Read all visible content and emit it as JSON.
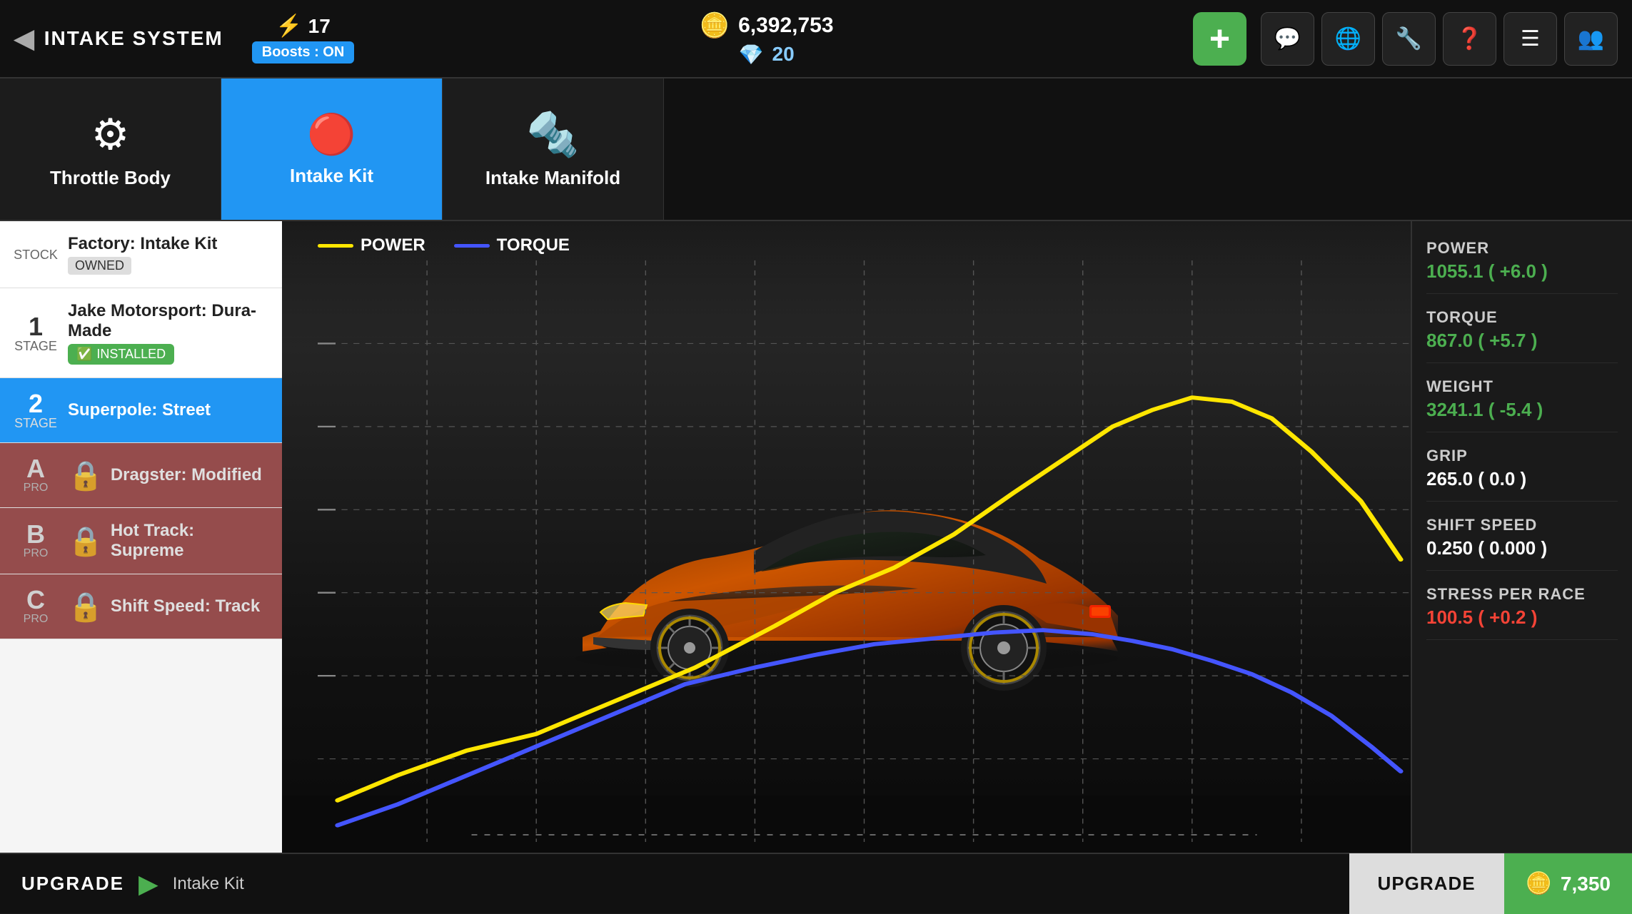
{
  "header": {
    "back_label": "INTAKE SYSTEM",
    "energy_count": "17",
    "boosts_label": "Boosts : ON",
    "currency": "6,392,753",
    "gems": "20",
    "add_label": "+",
    "icons": [
      "💬",
      "🌐",
      "🔧",
      "❓",
      "☰",
      "👥"
    ]
  },
  "tabs": [
    {
      "id": "throttle-body",
      "label": "Throttle Body",
      "icon": "⚙"
    },
    {
      "id": "intake-kit",
      "label": "Intake Kit",
      "icon": "🔴",
      "active": true
    },
    {
      "id": "intake-manifold",
      "label": "Intake Manifold",
      "icon": "🔩"
    }
  ],
  "upgrades": [
    {
      "id": "stock",
      "stage": "",
      "stage_label": "STOCK",
      "name": "Factory: Intake Kit",
      "status": "owned",
      "status_label": "OWNED",
      "locked": false,
      "selected": false
    },
    {
      "id": "stage1",
      "stage": "1",
      "stage_label": "STAGE",
      "name": "Jake Motorsport: Dura-Made",
      "status": "installed",
      "status_label": "INSTALLED",
      "locked": false,
      "selected": false
    },
    {
      "id": "stage2",
      "stage": "2",
      "stage_label": "STAGE",
      "name": "Superpole: Street",
      "status": "selected",
      "locked": false,
      "selected": true
    },
    {
      "id": "stagea",
      "stage": "A",
      "stage_label": "PRO",
      "name": "Dragster: Modified",
      "status": "locked",
      "locked": true,
      "selected": false
    },
    {
      "id": "stageb",
      "stage": "B",
      "stage_label": "PRO",
      "name": "Hot Track: Supreme",
      "status": "locked",
      "locked": true,
      "selected": false
    },
    {
      "id": "stagec",
      "stage": "C",
      "stage_label": "PRO",
      "name": "Shift Speed: Track",
      "status": "locked",
      "locked": true,
      "selected": false
    }
  ],
  "graph": {
    "legend": [
      {
        "id": "power",
        "label": "POWER",
        "color": "#FFE600"
      },
      {
        "id": "torque",
        "label": "TORQUE",
        "color": "#4455FF"
      }
    ]
  },
  "stats": [
    {
      "id": "power",
      "label": "POWER",
      "value": "1055.1 ( +6.0 )",
      "type": "positive"
    },
    {
      "id": "torque",
      "label": "TORQUE",
      "value": "867.0 ( +5.7 )",
      "type": "positive"
    },
    {
      "id": "weight",
      "label": "WEIGHT",
      "value": "3241.1 ( -5.4 )",
      "type": "positive"
    },
    {
      "id": "grip",
      "label": "GRIP",
      "value": "265.0 ( 0.0 )",
      "type": "neutral"
    },
    {
      "id": "shift-speed",
      "label": "SHIFT SPEED",
      "value": "0.250 ( 0.000 )",
      "type": "neutral"
    },
    {
      "id": "stress",
      "label": "STRESS PER RACE",
      "value": "100.5 ( +0.2 )",
      "type": "negative"
    }
  ],
  "bottom": {
    "upgrade_label": "UPGRADE",
    "arrow": "▶",
    "kit_name": "Intake Kit",
    "btn_label": "UPGRADE",
    "price": "7,350",
    "coin_icon": "💰"
  }
}
